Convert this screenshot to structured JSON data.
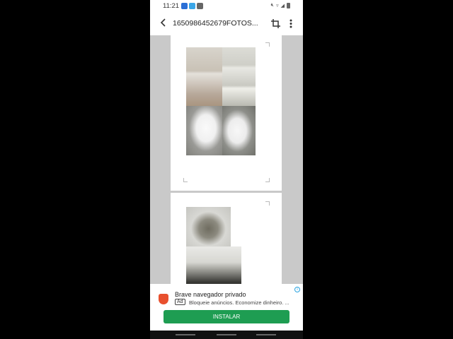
{
  "status_bar": {
    "time": "11:21"
  },
  "toolbar": {
    "title": "1650986452679FOTOS...",
    "icons": [
      "back-arrow-icon",
      "crop-icon",
      "more-vert-icon"
    ]
  },
  "document": {
    "pages": [
      {
        "photos": [
          "bathroom-shelf-photo",
          "bathroom-wall-photo",
          "toilet-photo-left",
          "toilet-photo-right"
        ]
      },
      {
        "photos": [
          "washing-machine-photo",
          "sink-photo"
        ]
      }
    ]
  },
  "ad": {
    "title": "Brave navegador privado",
    "badge": "Ad",
    "text": "Bloqueie anúncios. Economize dinheiro. ...",
    "button": "INSTALAR",
    "colors": {
      "button": "#1e9d52",
      "logo": "#e8502e"
    }
  }
}
